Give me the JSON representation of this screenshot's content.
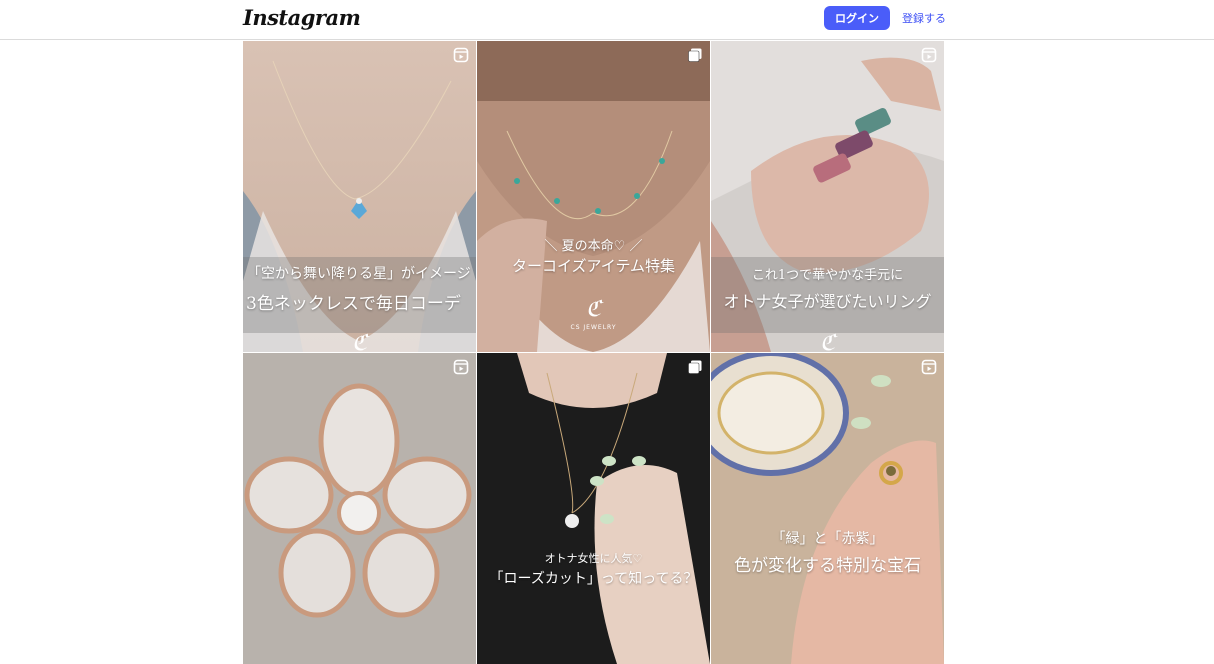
{
  "header": {
    "logo_text": "Instagram",
    "login_label": "ログイン",
    "signup_label": "登録する"
  },
  "posts": [
    {
      "type": "reel-icon",
      "line1": "「空から舞い降りる星」がイメージ",
      "line2": "3色ネックレスで毎日コーデ"
    },
    {
      "type": "carousel-icon",
      "line1": "＼ 夏の本命♡ ／",
      "line2": "ターコイズアイテム特集",
      "brand_sub": "CS JEWELRY"
    },
    {
      "type": "reel-icon",
      "line1": "これ1つで華やかな手元に",
      "line2": "オトナ女子が選びたいリング"
    },
    {
      "type": "reel-icon",
      "line1": "",
      "line2": ""
    },
    {
      "type": "carousel-icon",
      "line1": "オトナ女性に人気♡",
      "line2": "「ローズカット」って知ってる？"
    },
    {
      "type": "reel-icon",
      "line1": "「緑」と「赤紫」",
      "line2": "色が変化する特別な宝石"
    }
  ],
  "colors": {
    "accent": "#4a5df9",
    "link": "#3f51f5",
    "divider": "#dbdbdb"
  }
}
